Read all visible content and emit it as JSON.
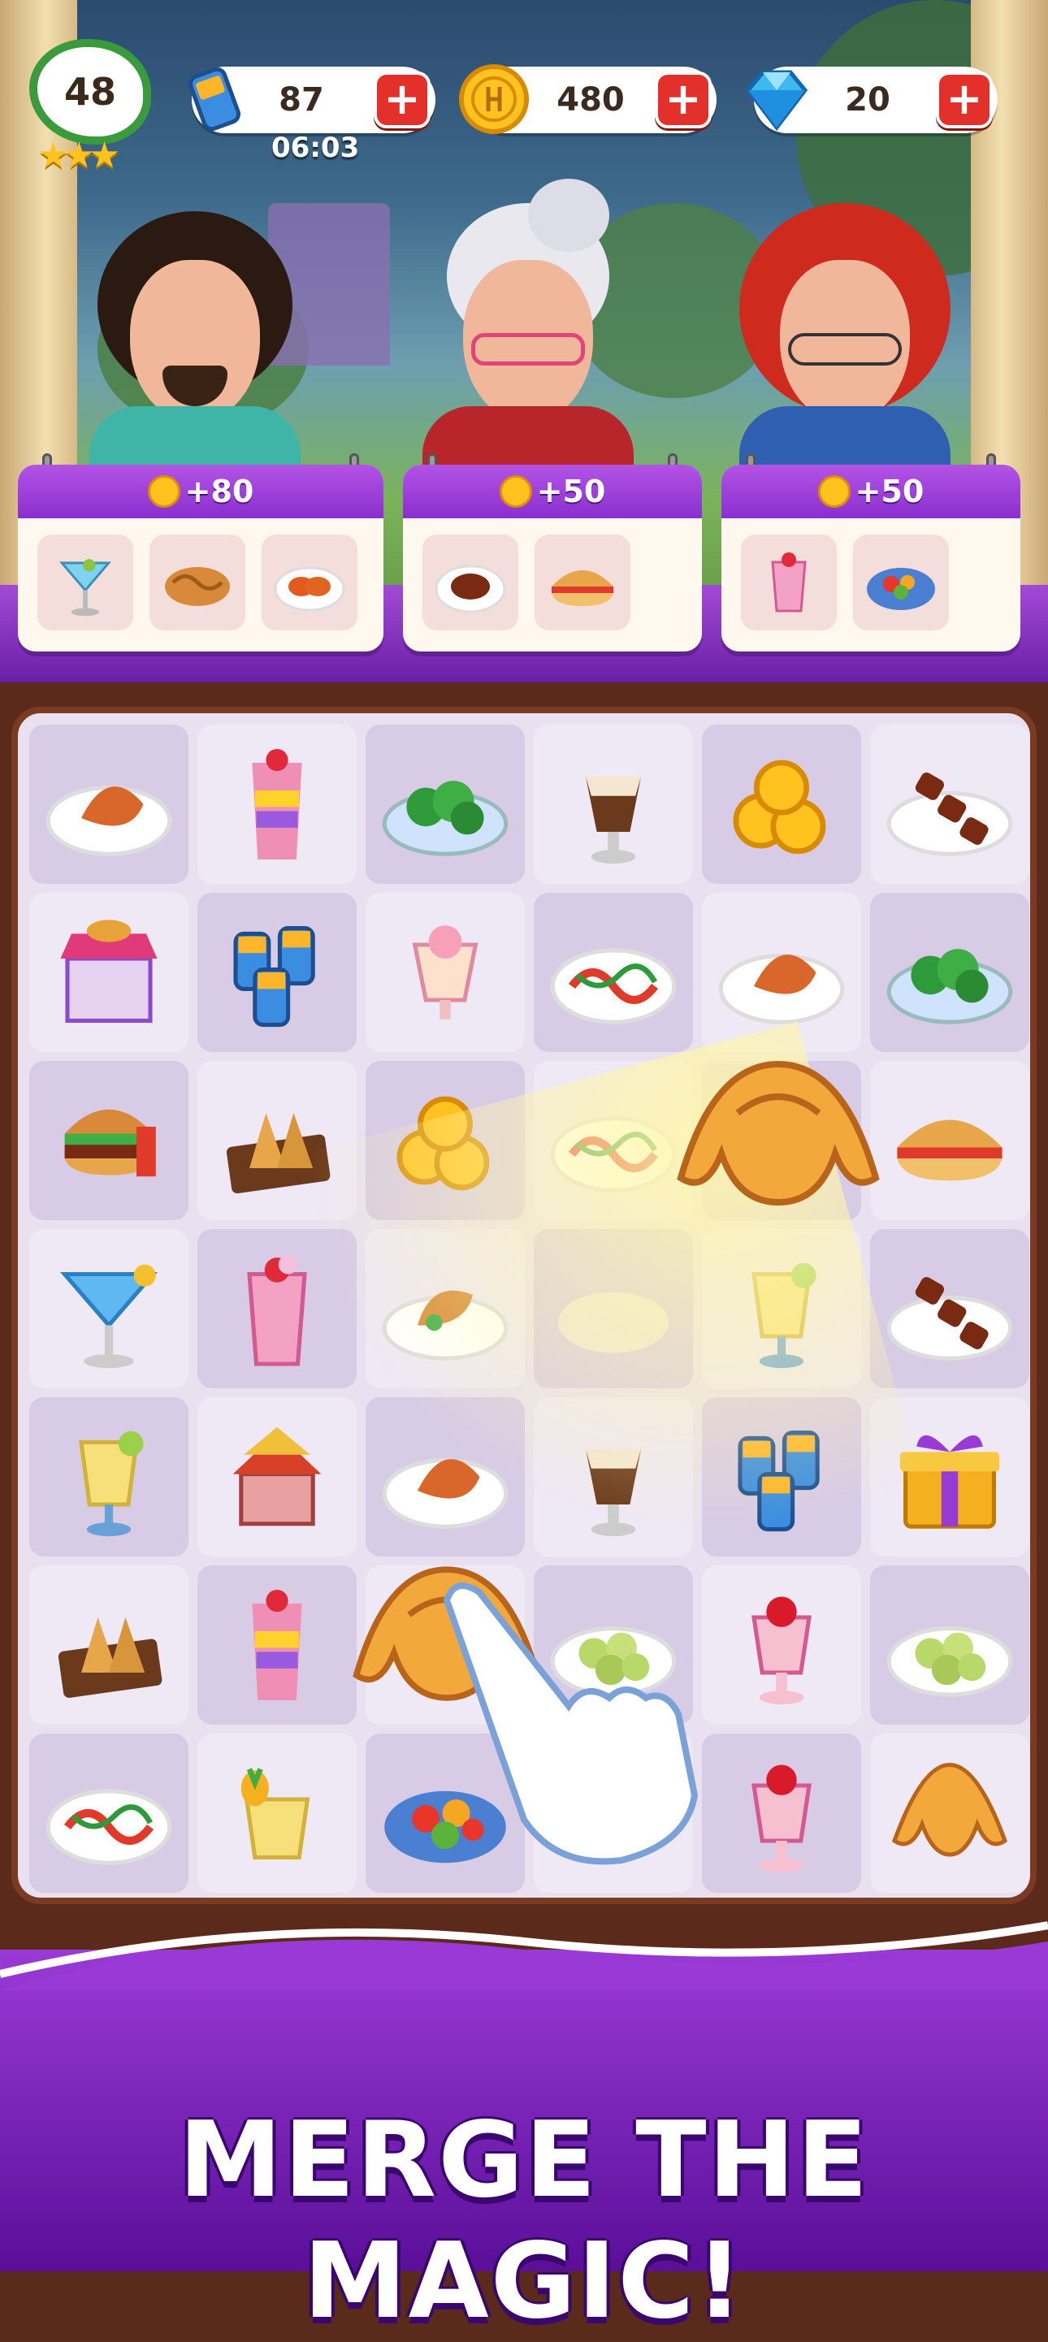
{
  "level": {
    "value": "48",
    "stars": "★★★"
  },
  "resources": {
    "energy": {
      "value": "87",
      "timer": "06:03",
      "icon": "battery-icon"
    },
    "coins": {
      "value": "480",
      "icon": "coin-icon"
    },
    "gems": {
      "value": "20",
      "icon": "diamond-icon"
    },
    "plus_label": "+"
  },
  "orders": [
    {
      "reward": "+80",
      "items": [
        "cocktail-dish",
        "bread-dish",
        "sliced-dish"
      ]
    },
    {
      "reward": "+50",
      "items": [
        "meat-plate-dish",
        "sandwich-dish"
      ]
    },
    {
      "reward": "+50",
      "items": [
        "smoothie-dish",
        "salad-dish"
      ]
    }
  ],
  "banner": {
    "title": "MERGE THE MAGIC!"
  },
  "colors": {
    "accent": "#8a2fcf",
    "coin": "#ffc21f",
    "plus": "#e3302a",
    "board": "#e9e1ef"
  }
}
